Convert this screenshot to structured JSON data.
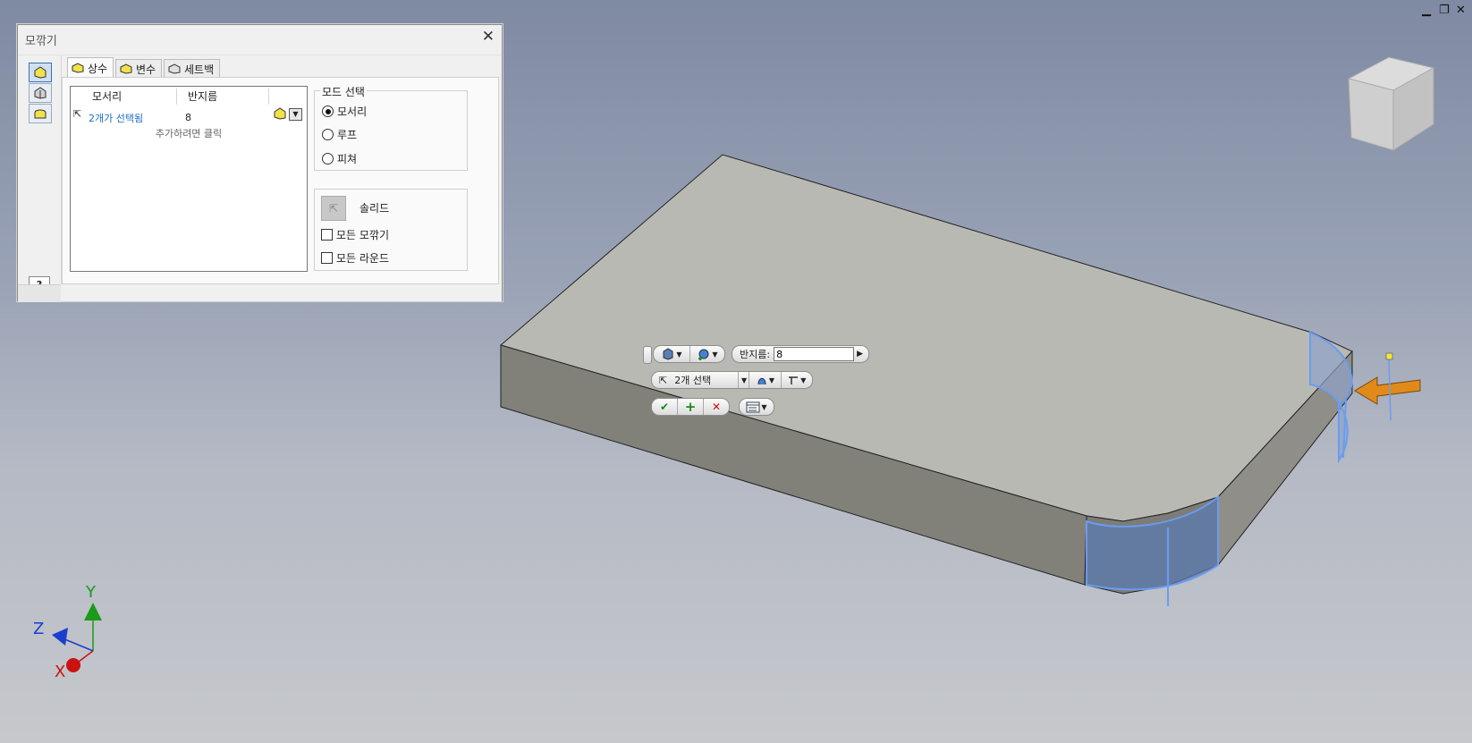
{
  "window_controls": {
    "minimize": "▁",
    "restore": "❐",
    "close": "✕"
  },
  "dialog": {
    "title": "모깎기",
    "close_glyph": "✕",
    "help_glyph": "?",
    "tabs": [
      {
        "label": "상수",
        "icon": "fillet-constant-icon"
      },
      {
        "label": "변수",
        "icon": "fillet-variable-icon"
      },
      {
        "label": "세트백",
        "icon": "fillet-setback-icon"
      }
    ],
    "table": {
      "headers": [
        "모서리",
        "반지름"
      ],
      "rows": [
        {
          "edges": "2개가 선택됨",
          "radius": "8"
        }
      ],
      "add_hint": "추가하려면 클릭"
    },
    "mode": {
      "legend": "모드 선택",
      "options": [
        "모서리",
        "루프",
        "피쳐"
      ],
      "selected": "모서리"
    },
    "solid_label": "솔리드",
    "checkboxes": [
      "모든 모깎기",
      "모든 라운드"
    ]
  },
  "mini_toolbar": {
    "radius_label": "반지름:",
    "radius_value": "8",
    "selection_label": "2개 선택"
  },
  "triad": {
    "x": "X",
    "y": "Y",
    "z": "Z"
  },
  "colors": {
    "selection": "#5c8fe6",
    "triad_x": "#cc1111",
    "triad_y": "#1a9a1a",
    "triad_z": "#1a3ecc",
    "arrow": "#e08a1a"
  }
}
